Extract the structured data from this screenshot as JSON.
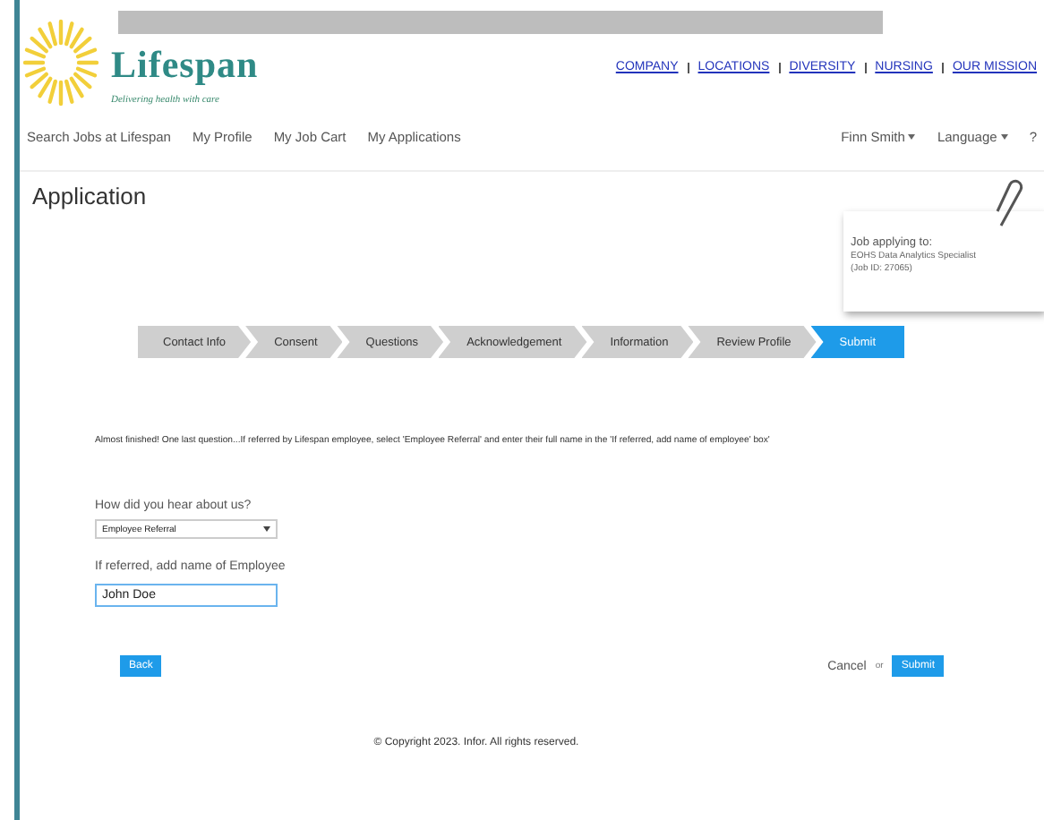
{
  "brand": {
    "name": "Lifespan",
    "tagline": "Delivering health with care"
  },
  "top_links": [
    "COMPANY",
    "LOCATIONS",
    "DIVERSITY",
    "NURSING",
    "OUR MISSION"
  ],
  "nav": [
    "Search Jobs at Lifespan",
    "My Profile",
    "My Job Cart",
    "My Applications"
  ],
  "user_menu": [
    "Finn Smith",
    "Language",
    "?"
  ],
  "page_title": "Application",
  "job_card": {
    "heading": "Job applying to:",
    "title": "EOHS Data Analytics Specialist",
    "job_id": "(Job ID: 27065)"
  },
  "steps": [
    {
      "label": "Contact Info",
      "selected": false
    },
    {
      "label": "Consent",
      "selected": false
    },
    {
      "label": "Questions",
      "selected": false
    },
    {
      "label": "Acknowledgement",
      "selected": false
    },
    {
      "label": "Information",
      "selected": false
    },
    {
      "label": "Review Profile",
      "selected": false
    },
    {
      "label": "Submit",
      "selected": true
    }
  ],
  "message": "Almost finished! One last question...If referred by Lifespan employee, select 'Employee Referral' and enter their full name in the 'If referred, add name of employee' box'",
  "fields": [
    {
      "kind": "select",
      "label": "How did you hear about us?",
      "value": "Employee Referral"
    },
    {
      "kind": "text",
      "label": "If referred, add name of Employee",
      "value": "John Doe"
    }
  ],
  "back_button": "Back",
  "cancel_link": "Cancel",
  "or_text": "or",
  "submit_button": "Submit",
  "footer": "© Copyright 2023. Infor. All rights reserved."
}
